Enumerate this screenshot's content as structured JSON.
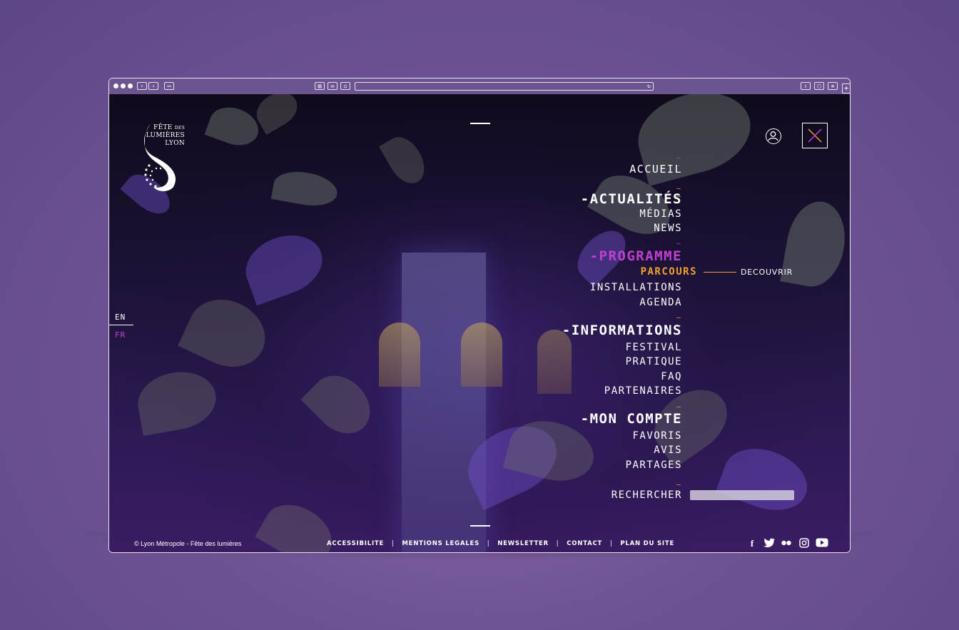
{
  "browser": {
    "reload_icon": "↻",
    "new_tab_icon": "+"
  },
  "language": {
    "en": "EN",
    "fr": "FR",
    "active_color": "#c040d0"
  },
  "logo": {
    "line1": "FÊTE",
    "line1_small": "DES",
    "line2": "LUMIÈRES",
    "line3": "LYON"
  },
  "menu": {
    "marker": "— —",
    "accueil": "ACCUEIL",
    "actualites": {
      "title": "-ACTUALITÉS",
      "items": [
        "MÉDIAS",
        "NEWS"
      ]
    },
    "programme": {
      "title": "-PROGRAMME",
      "active": "PARCOURS",
      "decouvrir": "DECOUVRIR",
      "items": [
        "INSTALLATIONS",
        "AGENDA"
      ]
    },
    "informations": {
      "title": "-INFORMATIONS",
      "items": [
        "FESTIVAL",
        "PRATIQUE",
        "FAQ",
        "PARTENAIRES"
      ]
    },
    "compte": {
      "title": "-MON COMPTE",
      "items": [
        "FAVORIS",
        "AVIS",
        "PARTAGES"
      ]
    },
    "search_label": "RECHERCHER",
    "colors": {
      "accent_orange": "#f0a030",
      "accent_purple": "#c040d0",
      "marker_purple": "#b040c8"
    }
  },
  "footer": {
    "copyright": "© Lyon Métropole - Fête des lumières",
    "links": [
      "ACCESSIBILITE",
      "MENTIONS LEGALES",
      "NEWSLETTER",
      "CONTACT",
      "PLAN DU SITE"
    ],
    "separator": "|",
    "social": [
      "facebook-icon",
      "twitter-icon",
      "flickr-icon",
      "instagram-icon",
      "youtube-icon"
    ]
  }
}
